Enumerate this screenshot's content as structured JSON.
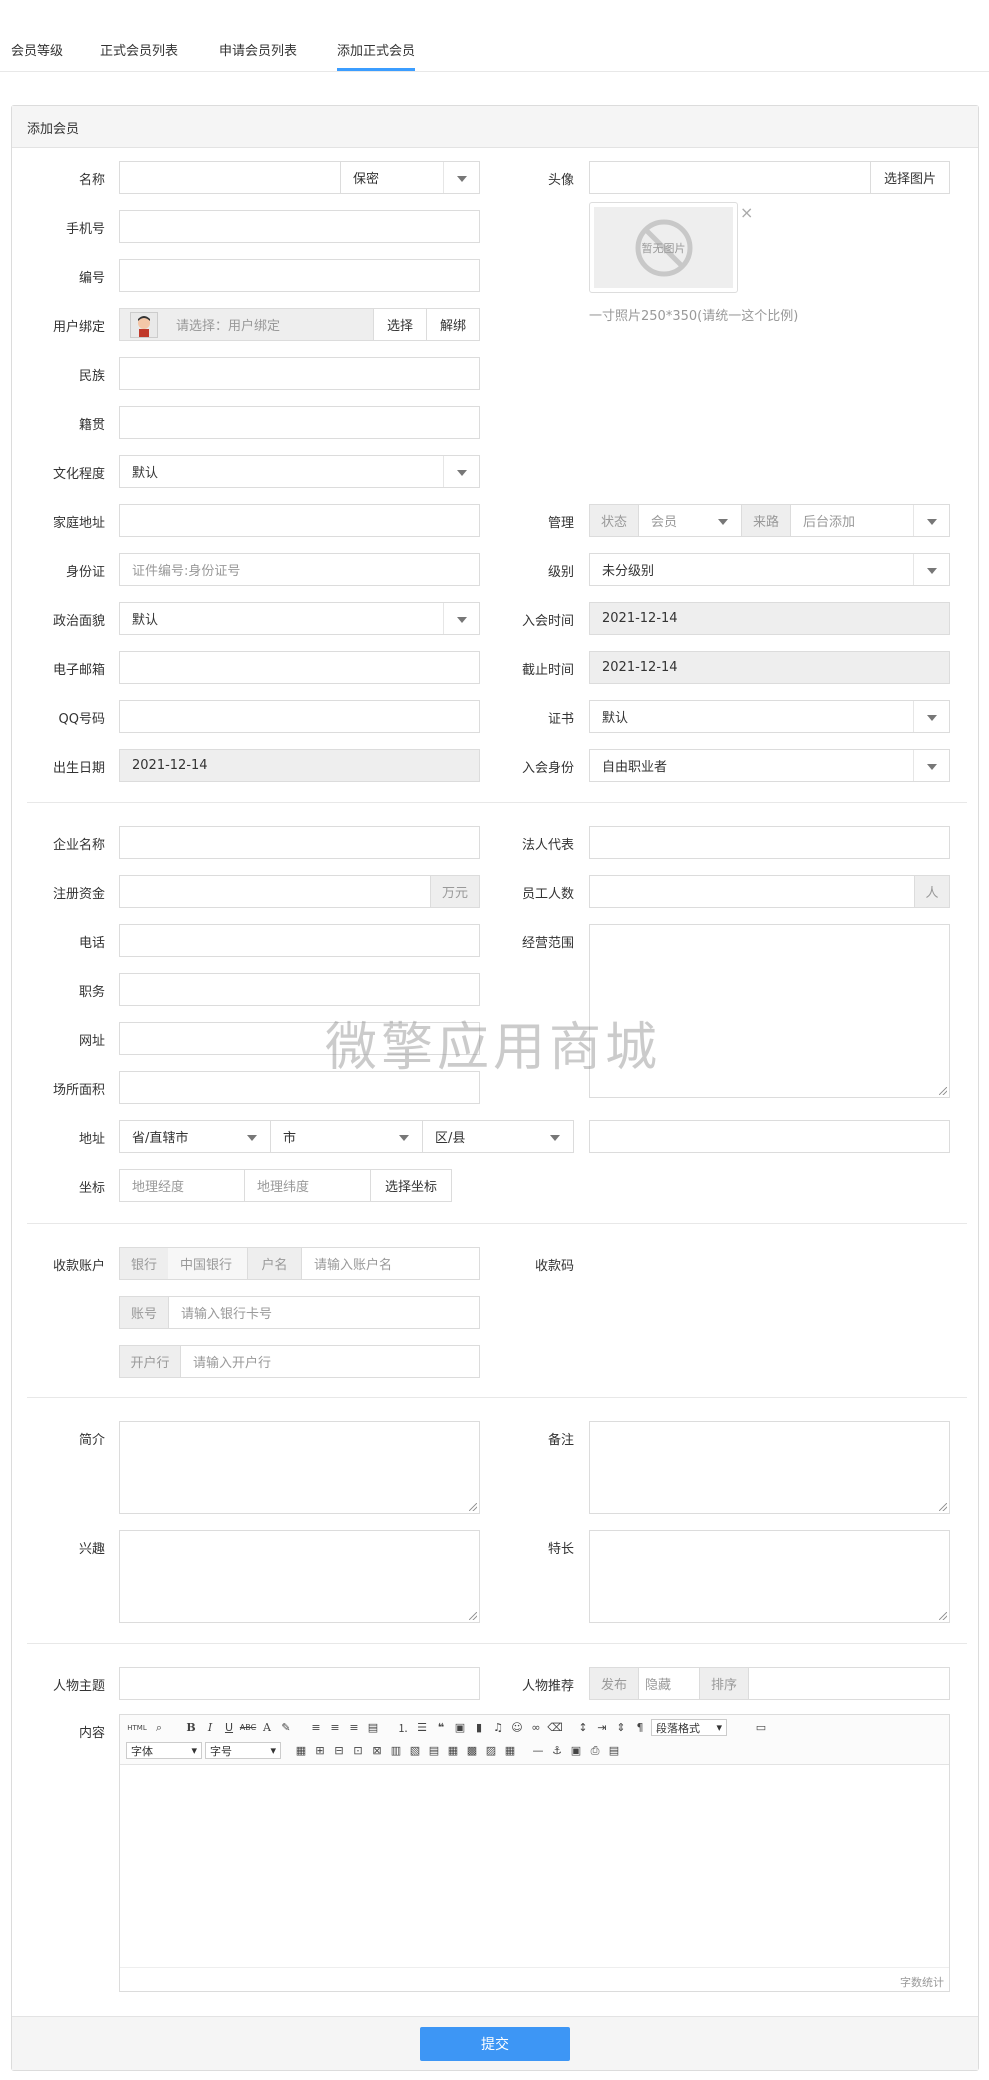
{
  "tabs": [
    "会员等级",
    "正式会员列表",
    "申请会员列表",
    "添加正式会员"
  ],
  "panel_title": "添加会员",
  "left1": {
    "name_label": "名称",
    "gender_value": "保密",
    "phone_label": "手机号",
    "number_label": "编号",
    "user_bind_label": "用户绑定",
    "user_bind_placeholder": "请选择：用户绑定",
    "select_btn": "选择",
    "unbind_btn": "解绑",
    "ethnic_label": "民族",
    "native_label": "籍贯",
    "education_label": "文化程度",
    "education_value": "默认",
    "address_label": "家庭地址",
    "idcard_label": "身份证",
    "idcard_placeholder": "证件编号:身份证号",
    "political_label": "政治面貌",
    "political_value": "默认",
    "email_label": "电子邮箱",
    "qq_label": "QQ号码",
    "birth_label": "出生日期",
    "birth_value": "2021-12-14"
  },
  "right1": {
    "avatar_label": "头像",
    "choose_image_btn": "选择图片",
    "no_image_text": "暂无图片",
    "avatar_hint": "一寸照片250*350(请统一这个比例)",
    "manage_label": "管理",
    "status_addon": "状态",
    "status_value": "会员",
    "source_addon": "来路",
    "source_value": "后台添加",
    "level_label": "级别",
    "level_value": "未分级别",
    "join_time_label": "入会时间",
    "join_time_value": "2021-12-14",
    "expire_label": "截止时间",
    "expire_value": "2021-12-14",
    "cert_label": "证书",
    "cert_value": "默认",
    "identity_label": "入会身份",
    "identity_value": "自由职业者"
  },
  "company": {
    "name_label": "企业名称",
    "legal_label": "法人代表",
    "capital_label": "注册资金",
    "capital_unit": "万元",
    "staff_label": "员工人数",
    "staff_unit": "人",
    "tel_label": "电话",
    "scope_label": "经营范围",
    "position_label": "职务",
    "website_label": "网址",
    "area_label": "场所面积",
    "addr_label": "地址",
    "province": "省/直辖市",
    "city": "市",
    "district": "区/县",
    "coord_label": "坐标",
    "lng_placeholder": "地理经度",
    "lat_placeholder": "地理纬度",
    "choose_coord_btn": "选择坐标"
  },
  "bank": {
    "label": "收款账户",
    "bank_addon": "银行",
    "bank_value": "中国银行",
    "holder_addon": "户名",
    "holder_placeholder": "请输入账户名",
    "account_addon": "账号",
    "account_placeholder": "请输入银行卡号",
    "branch_addon": "开户行",
    "branch_placeholder": "请输入开户行",
    "qrcode_label": "收款码"
  },
  "bio": {
    "intro_label": "简介",
    "remark_label": "备注",
    "hobby_label": "兴趣",
    "skill_label": "特长"
  },
  "extra": {
    "topic_label": "人物主题",
    "recommend_label": "人物推荐",
    "publish_addon": "发布",
    "hide_value": "隐藏",
    "sort_addon": "排序",
    "content_label": "内容",
    "font_family": "字体",
    "font_size": "字号",
    "para_format": "段落格式",
    "word_count": "字数统计",
    "html_btn": "HTML"
  },
  "submit_btn": "提交",
  "watermark": "微擎应用商城"
}
